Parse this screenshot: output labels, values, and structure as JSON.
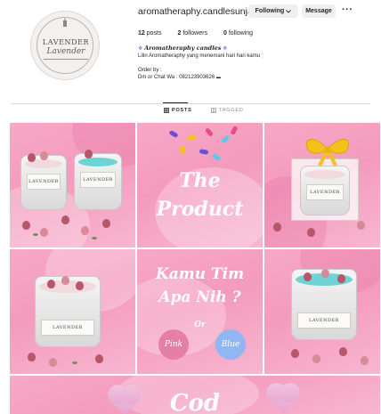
{
  "profile": {
    "username": "aromatheraphy.candlesunjay",
    "following_label": "Following",
    "message_label": "Message",
    "more_label": "···",
    "posts_count": "12",
    "posts_label": "posts",
    "followers_count": "2",
    "followers_label": "followers",
    "following_count": "0",
    "following_count_label": "following",
    "bio_title": "Aromatheraphy candles",
    "bio_line1": "Lilin Aromatheraphy yang menemani hari hari kamu",
    "bio_line2": "Order by :",
    "bio_line3": "Dm or Chat Wa : 082123903626",
    "avatar_brand": "LAVENDER",
    "avatar_script": "Lavender"
  },
  "tabs": {
    "posts": "POSTS",
    "tagged": "TAGGED"
  },
  "posts": {
    "jar_label": "LAVENDER",
    "product_line1": "The",
    "product_line2": "Product",
    "question_line1": "Kamu Tim",
    "question_line2": "Apa Nih ?",
    "or_label": "Or",
    "pink_label": "Pink",
    "blue_label": "Blue",
    "bottom_text": "Cod"
  },
  "colors": {
    "pink_bg": "#f49bbd",
    "pink_button": "#e57fa5",
    "blue_button": "#8fb8f2",
    "blue_wax": "#6fd3d6",
    "bow_yellow": "#f2c21b"
  }
}
